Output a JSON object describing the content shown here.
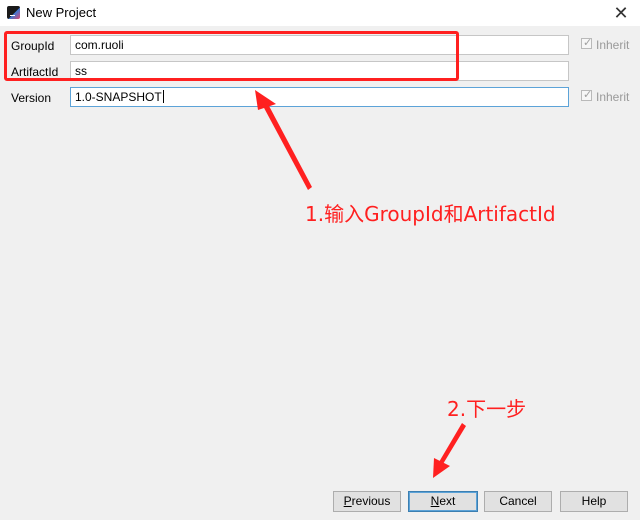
{
  "window": {
    "title": "New Project",
    "close_glyph": "✕"
  },
  "form": {
    "group_id": {
      "label": "GroupId",
      "value": "com.ruoli"
    },
    "artifact_id": {
      "label": "ArtifactId",
      "value": "ss"
    },
    "version": {
      "label": "Version",
      "value": "1.0-SNAPSHOT"
    },
    "inherit_label": "Inherit"
  },
  "annotations": {
    "step1": "1.输入GroupId和ArtifactId",
    "step2": "2.下一步",
    "color": "#ff2020"
  },
  "buttons": {
    "previous": {
      "mnemonic": "P",
      "rest": "revious"
    },
    "next": {
      "mnemonic": "N",
      "rest": "ext"
    },
    "cancel": "Cancel",
    "help": "Help"
  },
  "icons": {
    "app": "intellij-idea-icon",
    "close": "close-icon",
    "check": "check-icon"
  }
}
